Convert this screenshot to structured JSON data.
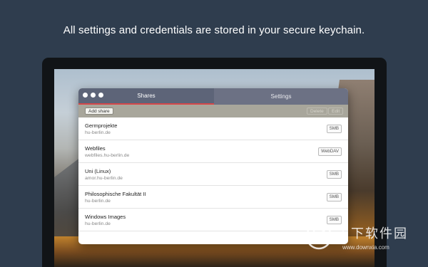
{
  "headline": "All settings and credentials are stored in your secure keychain.",
  "window": {
    "tabs": [
      {
        "label": "Shares",
        "active": true
      },
      {
        "label": "Settings",
        "active": false
      }
    ],
    "toolbar": {
      "add_label": "Add share",
      "delete_label": "Delete",
      "edit_label": "Edit"
    },
    "shares": [
      {
        "name": "Germprojekte",
        "host": "hu-berlin.de",
        "type": "SMB"
      },
      {
        "name": "Webfiles",
        "host": "webfiles.hu-berlin.de",
        "type": "WebDAV"
      },
      {
        "name": "Uni (Linux)",
        "host": "amor.hu-berlin.de",
        "type": "SMB"
      },
      {
        "name": "Philosophische Fakultät II",
        "host": "hu-berlin.de",
        "type": "SMB"
      },
      {
        "name": "Windows Images",
        "host": "hu-berlin.de",
        "type": "SMB"
      }
    ]
  },
  "watermark": {
    "text": "当下软件园",
    "url": "www.downxia.com"
  },
  "colors": {
    "background": "#2f3d4e",
    "active_tab": "#5d6478",
    "tab_underline": "#d5474a",
    "toolbar": "#a8a69b"
  }
}
